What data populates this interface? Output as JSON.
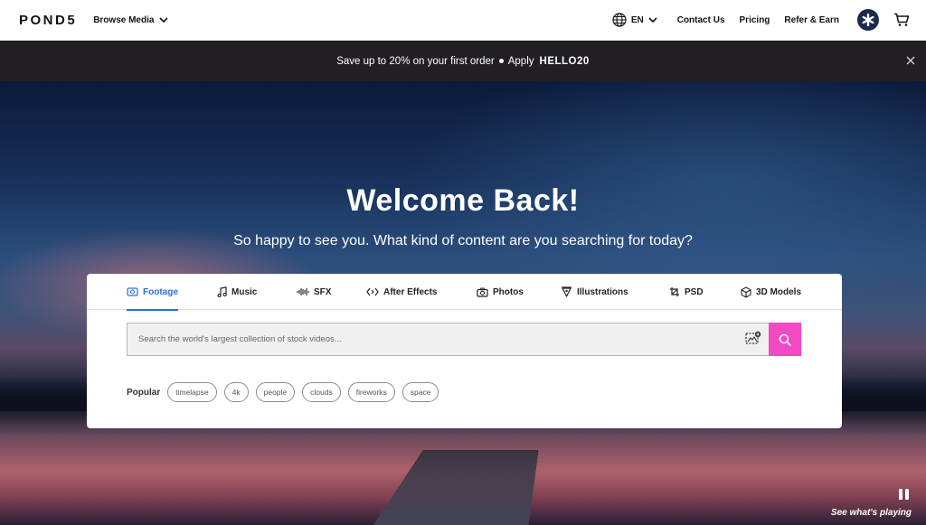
{
  "nav": {
    "logo": "POND5",
    "browse_label": "Browse Media",
    "lang": "EN",
    "links": [
      "Contact Us",
      "Pricing",
      "Refer & Earn"
    ]
  },
  "promo": {
    "text": "Save up to 20% on your first order",
    "apply": "Apply",
    "code": "HELLO20"
  },
  "hero": {
    "title": "Welcome Back!",
    "subtitle": "So happy to see you. What kind of content are you searching for today?"
  },
  "search": {
    "tabs": [
      {
        "label": "Footage",
        "icon": "footage-icon",
        "active": true
      },
      {
        "label": "Music",
        "icon": "music-icon"
      },
      {
        "label": "SFX",
        "icon": "sfx-icon"
      },
      {
        "label": "After Effects",
        "icon": "after-effects-icon"
      },
      {
        "label": "Photos",
        "icon": "camera-icon"
      },
      {
        "label": "Illustrations",
        "icon": "pen-nib-icon"
      },
      {
        "label": "PSD",
        "icon": "psd-icon"
      },
      {
        "label": "3D Models",
        "icon": "cube-icon"
      }
    ],
    "placeholder": "Search the world's largest collection of stock videos...",
    "popular_label": "Popular",
    "popular_tags": [
      "timelapse",
      "4k",
      "people",
      "clouds",
      "fireworks",
      "space"
    ]
  },
  "footer": {
    "playing_label": "See what's playing"
  },
  "colors": {
    "accent": "#f24ac2",
    "active_tab": "#2b6fd6",
    "promo_bg": "#221f24"
  }
}
